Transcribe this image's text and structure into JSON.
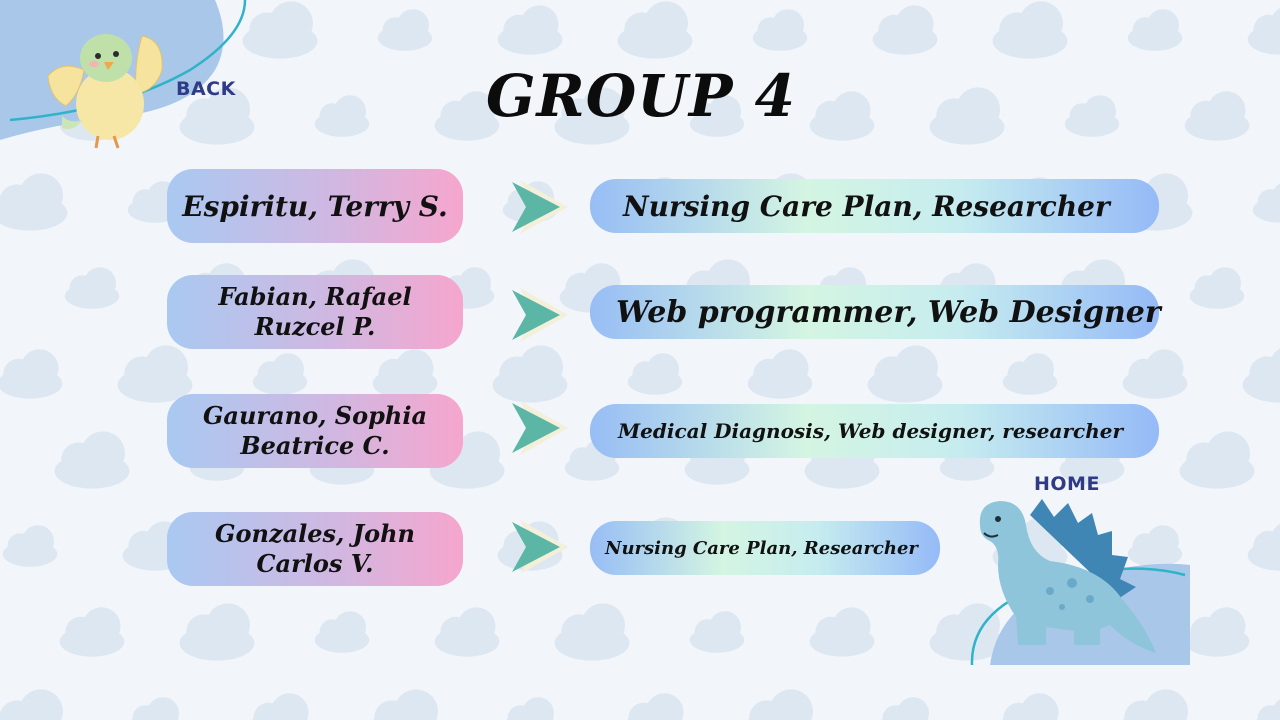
{
  "title": "GROUP 4",
  "nav": {
    "back_label": "BACK",
    "home_label": "HOME"
  },
  "members": [
    {
      "name": "Espiritu, Terry S.",
      "role": "Nursing Care Plan, Researcher"
    },
    {
      "name": "Fabian, Rafael Ruzcel P.",
      "role": "Web programmer, Web Designer"
    },
    {
      "name": "Gaurano, Sophia Beatrice C.",
      "role": "Medical Diagnosis, Web designer, researcher"
    },
    {
      "name": "Gonzales, John Carlos V.",
      "role": "Nursing Care Plan, Researcher"
    }
  ],
  "icons": [
    "bird-illustration",
    "dinosaur-illustration",
    "chevron-arrow-icon",
    "cloud-pattern"
  ],
  "colors": {
    "background": "#f2f5f9",
    "nav_text": "#2f3b85",
    "arrow_teal": "#5bb6a6",
    "corner_blue": "#a9c7e8",
    "corner_line": "#2fb3c8"
  }
}
